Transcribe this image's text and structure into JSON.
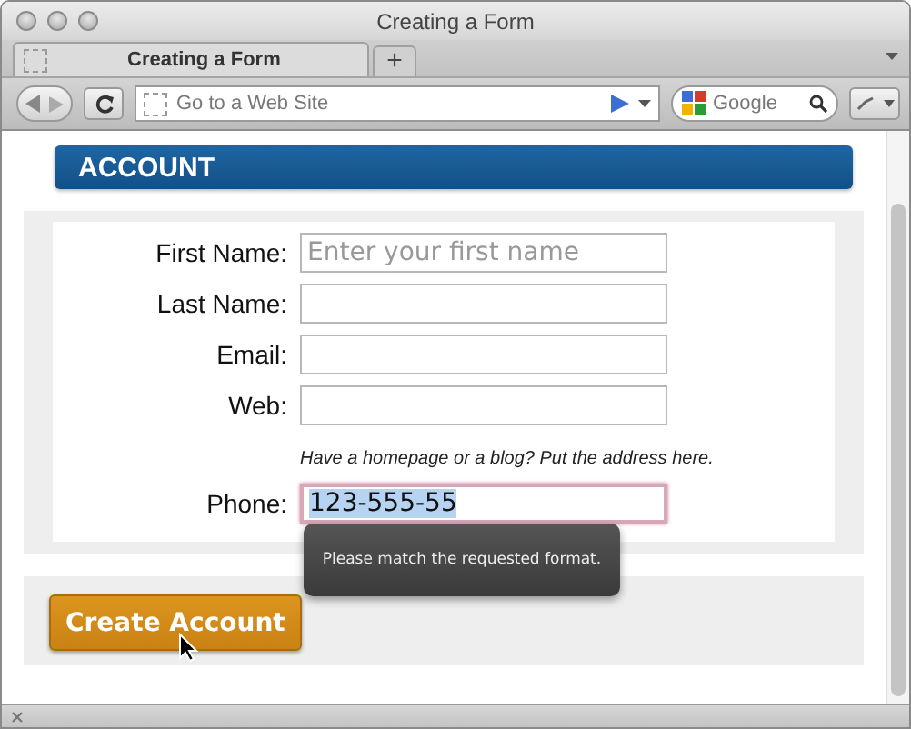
{
  "window": {
    "title": "Creating a Form"
  },
  "tabs": [
    {
      "title": "Creating a Form",
      "selected": true
    }
  ],
  "new_tab_button": "+",
  "address_field": {
    "placeholder": "Go to a Web Site"
  },
  "search_field": {
    "placeholder": "Google"
  },
  "section_title": "ACCOUNT",
  "fields": [
    {
      "label": "First Name:",
      "placeholder": "Enter your first name"
    },
    {
      "label": "Last Name:"
    },
    {
      "label": "Email:"
    },
    {
      "label": "Web:",
      "hint": "Have a homepage or a blog? Put the address here."
    },
    {
      "label": "Phone:",
      "value": "123-555-55",
      "text_selected": true,
      "invalid": true,
      "validation_message": "Please match the requested format."
    }
  ],
  "submit_button": "Create Account"
}
